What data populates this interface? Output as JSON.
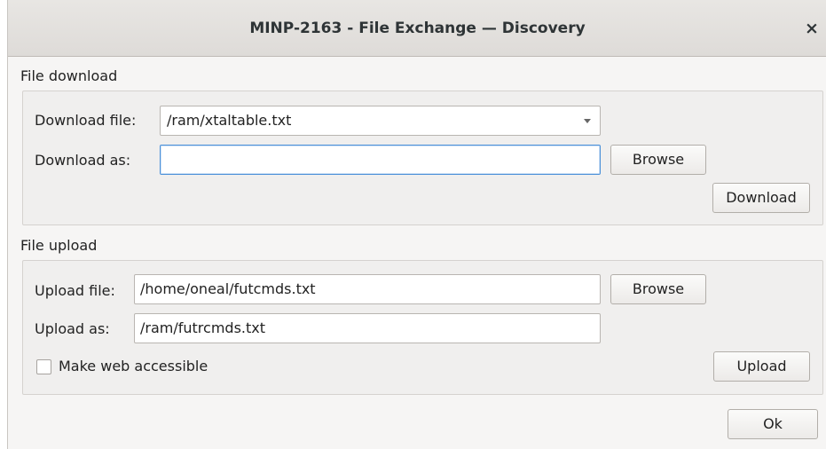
{
  "window": {
    "title": "MINP-2163 - File Exchange — Discovery",
    "close_glyph": "×"
  },
  "download": {
    "section_label": "File download",
    "file_label": "Download file:",
    "file_value": "/ram/xtaltable.txt",
    "as_label": "Download as:",
    "as_value": "",
    "browse_label": "Browse",
    "action_label": "Download"
  },
  "upload": {
    "section_label": "File upload",
    "file_label": "Upload file:",
    "file_value": "/home/oneal/futcmds.txt",
    "as_label": "Upload as:",
    "as_value": "/ram/futrcmds.txt",
    "browse_label": "Browse",
    "web_accessible_label": "Make web accessible",
    "web_accessible_checked": false,
    "action_label": "Upload"
  },
  "footer": {
    "ok_label": "Ok"
  }
}
